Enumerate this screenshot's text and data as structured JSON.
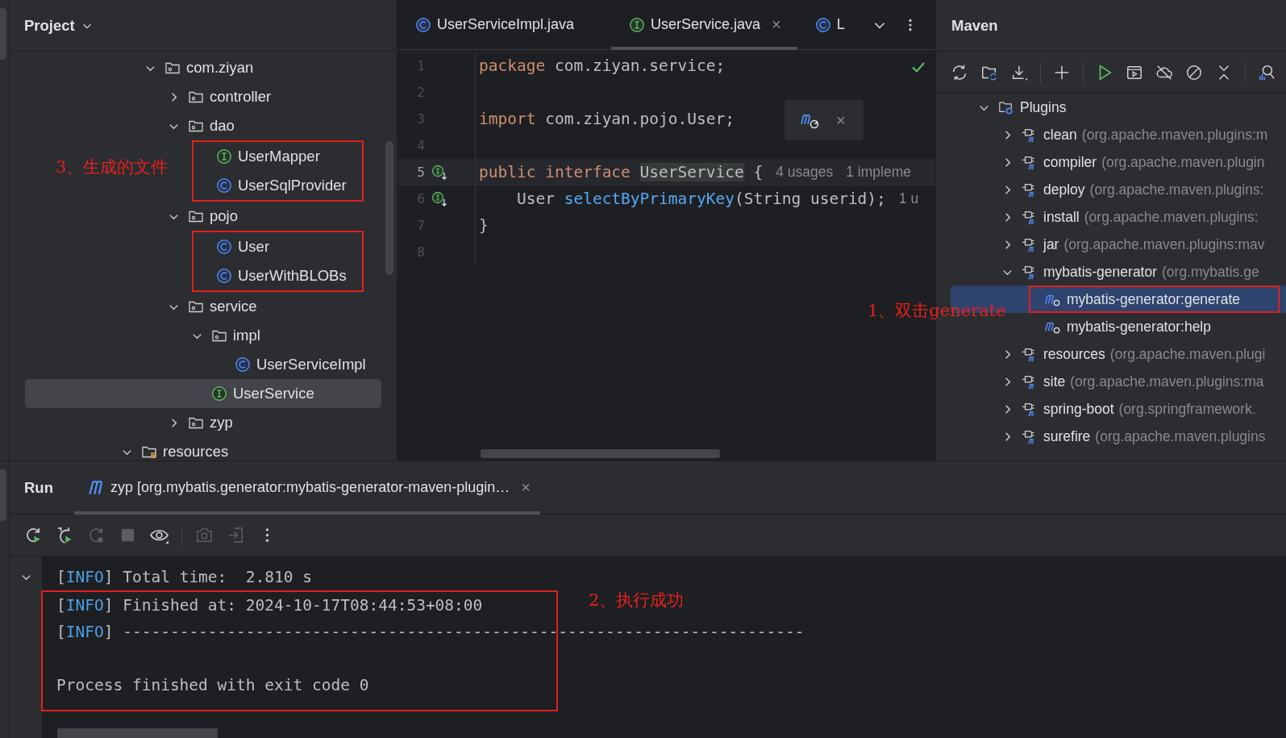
{
  "project": {
    "title": "Project",
    "tree": [
      {
        "label": "com.ziyan",
        "kind": "package",
        "expanded": true,
        "selected": false,
        "children": [
          {
            "label": "controller",
            "kind": "package",
            "expanded": false,
            "selected": false
          },
          {
            "label": "dao",
            "kind": "package",
            "expanded": true,
            "selected": false,
            "children": [
              {
                "label": "UserMapper",
                "kind": "interface",
                "selected": false,
                "boxed": true
              },
              {
                "label": "UserSqlProvider",
                "kind": "class",
                "selected": false,
                "boxed": true
              }
            ]
          },
          {
            "label": "pojo",
            "kind": "package",
            "expanded": true,
            "selected": false,
            "children": [
              {
                "label": "User",
                "kind": "class",
                "selected": false,
                "boxed": true
              },
              {
                "label": "UserWithBLOBs",
                "kind": "class",
                "selected": false,
                "boxed": true
              }
            ]
          },
          {
            "label": "service",
            "kind": "package",
            "expanded": true,
            "selected": false,
            "children": [
              {
                "label": "impl",
                "kind": "package",
                "expanded": true,
                "selected": false,
                "children": [
                  {
                    "label": "UserServiceImpl",
                    "kind": "class",
                    "selected": false
                  }
                ]
              },
              {
                "label": "UserService",
                "kind": "interface",
                "selected": true
              }
            ]
          },
          {
            "label": "zyp",
            "kind": "package",
            "expanded": false,
            "selected": false
          }
        ]
      }
    ],
    "parent_level_items": [
      {
        "label": "resources",
        "kind": "resources",
        "expanded": true,
        "selected": false
      }
    ],
    "annotation": "3、生成的文件"
  },
  "editor": {
    "tabs": [
      {
        "label": "UserServiceImpl.java",
        "kind": "class",
        "selected": false
      },
      {
        "label": "UserService.java",
        "kind": "interface",
        "selected": true,
        "close": "×"
      },
      {
        "label": "L",
        "kind": "class",
        "selected": false
      }
    ],
    "no_problems": true,
    "popup": {
      "close": "×"
    },
    "lines": [
      {
        "number": "1",
        "current": false,
        "tokens": [
          {
            "text": "package",
            "kind": "keyword"
          },
          {
            "text": " com.ziyan.service;",
            "kind": "plain"
          }
        ]
      },
      {
        "number": "2",
        "current": false
      },
      {
        "number": "3",
        "current": false,
        "tokens": [
          {
            "text": "import",
            "kind": "keyword"
          },
          {
            "text": " com.ziyan.pojo.User;",
            "kind": "plain"
          }
        ]
      },
      {
        "number": "4",
        "current": false
      },
      {
        "number": "5",
        "current": true,
        "impl_marker": true,
        "tokens": [
          {
            "text": "public ",
            "kind": "keyword"
          },
          {
            "text": "interface ",
            "kind": "keyword"
          },
          {
            "text": "UserService",
            "kind": "usage"
          },
          {
            "text": " {",
            "kind": "plain"
          }
        ],
        "hints": [
          "4 usages",
          "1 impleme"
        ]
      },
      {
        "number": "6",
        "current": false,
        "impl_marker": true,
        "tokens": [
          {
            "text": "    User ",
            "kind": "plain"
          },
          {
            "text": "selectByPrimaryKey",
            "kind": "method"
          },
          {
            "text": "(String userid);",
            "kind": "plain"
          }
        ],
        "hints": [
          "1 u"
        ]
      },
      {
        "number": "7",
        "current": false,
        "tokens": [
          {
            "text": "}",
            "kind": "plain"
          }
        ]
      },
      {
        "number": "8",
        "current": false
      }
    ]
  },
  "maven": {
    "title": "Maven",
    "tree": [
      {
        "label": "Plugins",
        "kind": "plugins",
        "expanded": true,
        "selected": false,
        "children": [
          {
            "label": "clean",
            "group": "(org.apache.maven.plugins:m",
            "kind": "plugin",
            "expanded": false,
            "selected": false
          },
          {
            "label": "compiler",
            "group": "(org.apache.maven.plugin",
            "kind": "plugin",
            "expanded": false,
            "selected": false
          },
          {
            "label": "deploy",
            "group": "(org.apache.maven.plugins:",
            "kind": "plugin",
            "expanded": false,
            "selected": false
          },
          {
            "label": "install",
            "group": "(org.apache.maven.plugins:",
            "kind": "plugin",
            "expanded": false,
            "selected": false
          },
          {
            "label": "jar",
            "group": "(org.apache.maven.plugins:mav",
            "kind": "plugin",
            "expanded": false,
            "selected": false
          },
          {
            "label": "mybatis-generator",
            "group": "(org.mybatis.ge",
            "kind": "plugin",
            "expanded": true,
            "selected": false,
            "children": [
              {
                "label": "mybatis-generator:generate",
                "kind": "goal",
                "selected": true,
                "boxed": true
              },
              {
                "label": "mybatis-generator:help",
                "kind": "goal",
                "selected": false
              }
            ]
          },
          {
            "label": "resources",
            "group": "(org.apache.maven.plugi",
            "kind": "plugin",
            "expanded": false,
            "selected": false
          },
          {
            "label": "site",
            "group": "(org.apache.maven.plugins:ma",
            "kind": "plugin",
            "expanded": false,
            "selected": false
          },
          {
            "label": "spring-boot",
            "group": "(org.springframework.",
            "kind": "plugin",
            "expanded": false,
            "selected": false
          },
          {
            "label": "surefire",
            "group": "(org.apache.maven.plugins",
            "kind": "plugin",
            "expanded": false,
            "selected": false
          }
        ]
      }
    ],
    "annotation": "1、双击generate"
  },
  "run": {
    "title": "Run",
    "tab": {
      "label": "zyp [org.mybatis.generator:mybatis-generator-maven-plugin…",
      "close": "×",
      "selected": true
    },
    "toolbar": [
      {
        "kind": "rerun",
        "disabled": false
      },
      {
        "kind": "rerun-failed",
        "disabled": false
      },
      {
        "kind": "restart",
        "disabled": true
      },
      {
        "kind": "stop",
        "disabled": true
      },
      {
        "kind": "watch",
        "disabled": false
      },
      {
        "kind": "separator"
      },
      {
        "kind": "screenshot",
        "disabled": true
      },
      {
        "kind": "exit",
        "disabled": true
      },
      {
        "kind": "more",
        "disabled": false
      }
    ],
    "console": {
      "annotation": "2、执行成功",
      "lines": [
        {
          "kind": "text",
          "boxed": false,
          "expanded": true,
          "segments": [
            {
              "text": "[",
              "kind": "plain"
            },
            {
              "text": "INFO",
              "kind": "info"
            },
            {
              "text": "] Total time:  2.810 s",
              "kind": "plain"
            }
          ]
        },
        {
          "kind": "text",
          "boxed": true,
          "segments": [
            {
              "text": "[",
              "kind": "plain"
            },
            {
              "text": "INFO",
              "kind": "info"
            },
            {
              "text": "] Finished at: 2024-10-17T08:44:53+08:00",
              "kind": "plain"
            }
          ]
        },
        {
          "kind": "text",
          "boxed": true,
          "segments": [
            {
              "text": "[",
              "kind": "plain"
            },
            {
              "text": "INFO",
              "kind": "info"
            },
            {
              "text": "] ------------------------------------------------------------------------",
              "kind": "plain"
            }
          ]
        },
        {
          "kind": "blank",
          "boxed": true
        },
        {
          "kind": "text",
          "boxed": true,
          "segments": [
            {
              "text": "Process finished with exit code 0",
              "kind": "plain"
            }
          ]
        }
      ]
    }
  }
}
